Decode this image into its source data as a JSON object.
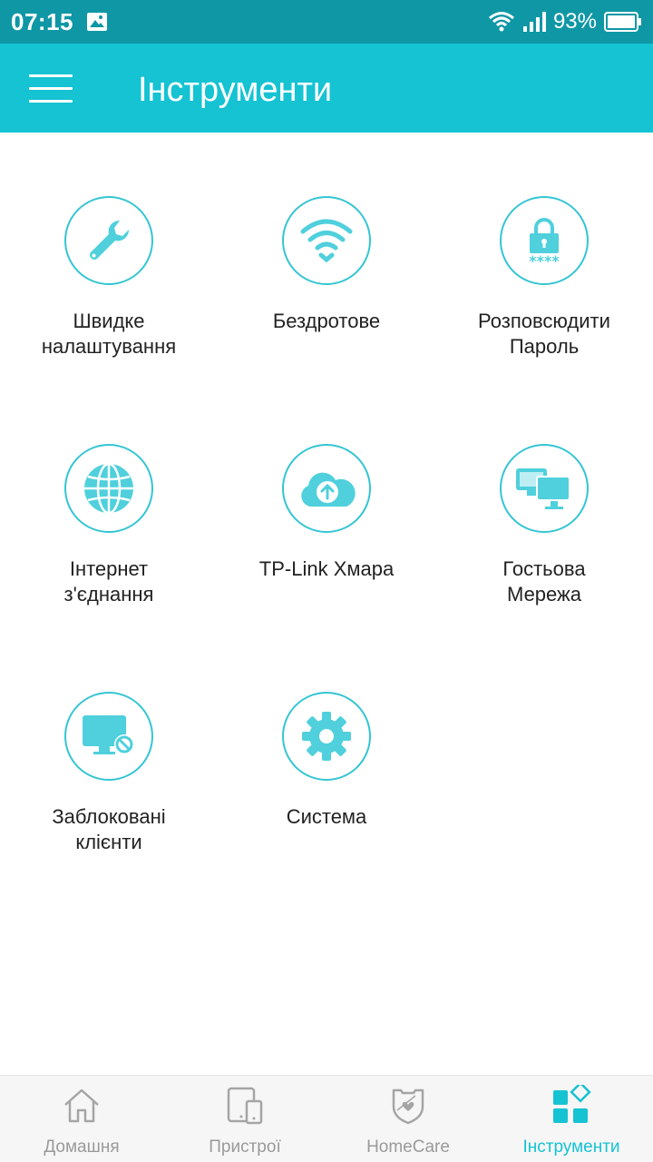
{
  "status_bar": {
    "time": "07:15",
    "battery": "93%",
    "icons": [
      "gallery-icon",
      "wifi-icon",
      "signal-icon",
      "battery-icon"
    ]
  },
  "app_bar": {
    "title": "Інструменти",
    "menu_icon": "hamburger-icon"
  },
  "tools": [
    {
      "label": "Швидке\nналаштування",
      "icon": "wrench-icon"
    },
    {
      "label": "Бездротове",
      "icon": "wifi-icon"
    },
    {
      "label": "Розповсюдити\nПароль",
      "icon": "lock-icon"
    },
    {
      "label": "Інтернет\nз'єднання",
      "icon": "globe-icon"
    },
    {
      "label": "TP-Link Хмара",
      "icon": "cloud-upload-icon"
    },
    {
      "label": "Гостьова\nМережа",
      "icon": "monitors-icon"
    },
    {
      "label": "Заблоковані\nклієнти",
      "icon": "blocked-monitor-icon"
    },
    {
      "label": "Система",
      "icon": "gear-icon"
    }
  ],
  "bottom_nav": [
    {
      "label": "Домашня",
      "icon": "home-icon",
      "active": false
    },
    {
      "label": "Пристрої",
      "icon": "devices-icon",
      "active": false
    },
    {
      "label": "HomeCare",
      "icon": "shield-heart-icon",
      "active": false
    },
    {
      "label": "Інструменти",
      "icon": "tools-grid-icon",
      "active": true
    }
  ],
  "colors": {
    "status_bar": "#0f97a5",
    "app_bar": "#15c3d3",
    "accent": "#34c5d3",
    "icon_fill": "#4fd0dc",
    "inactive_nav": "#9a9a9a"
  }
}
